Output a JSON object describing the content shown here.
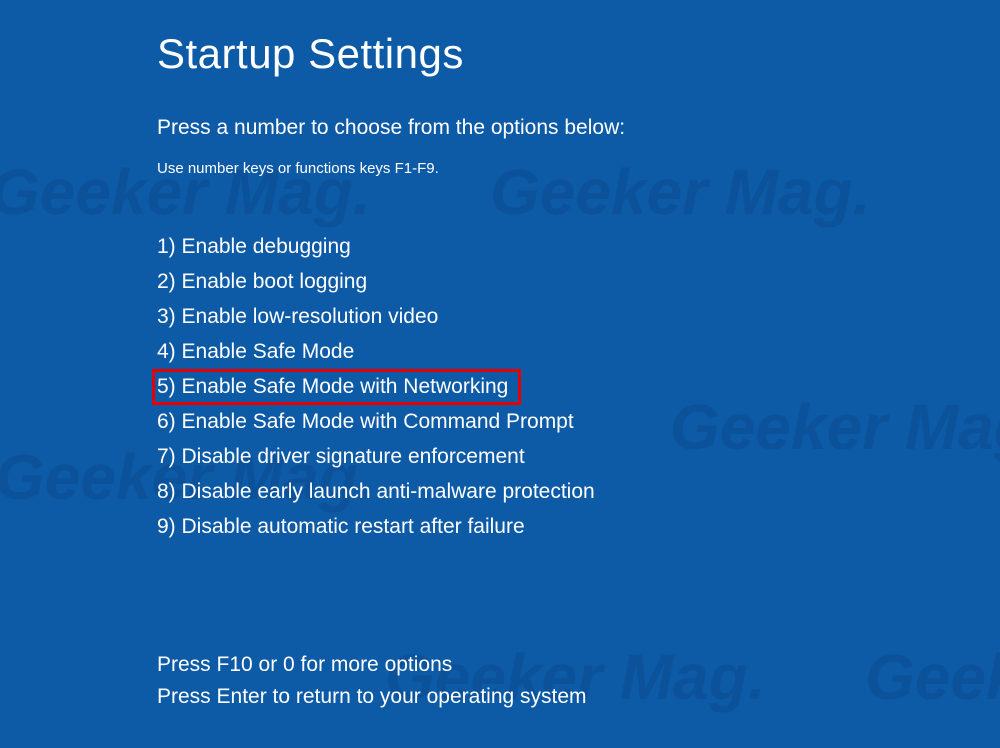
{
  "watermark_text": "Geeker Mag.",
  "title": "Startup Settings",
  "subtitle": "Press a number to choose from the options below:",
  "hint": "Use number keys or functions keys F1-F9.",
  "options": [
    {
      "num": "1",
      "label": "Enable debugging",
      "highlighted": false
    },
    {
      "num": "2",
      "label": "Enable boot logging",
      "highlighted": false
    },
    {
      "num": "3",
      "label": "Enable low-resolution video",
      "highlighted": false
    },
    {
      "num": "4",
      "label": "Enable Safe Mode",
      "highlighted": false
    },
    {
      "num": "5",
      "label": "Enable Safe Mode with Networking",
      "highlighted": true
    },
    {
      "num": "6",
      "label": "Enable Safe Mode with Command Prompt",
      "highlighted": false
    },
    {
      "num": "7",
      "label": "Disable driver signature enforcement",
      "highlighted": false
    },
    {
      "num": "8",
      "label": "Disable early launch anti-malware protection",
      "highlighted": false
    },
    {
      "num": "9",
      "label": "Disable automatic restart after failure",
      "highlighted": false
    }
  ],
  "footer_more": "Press F10 or 0 for more options",
  "footer_return": "Press Enter to return to your operating system"
}
